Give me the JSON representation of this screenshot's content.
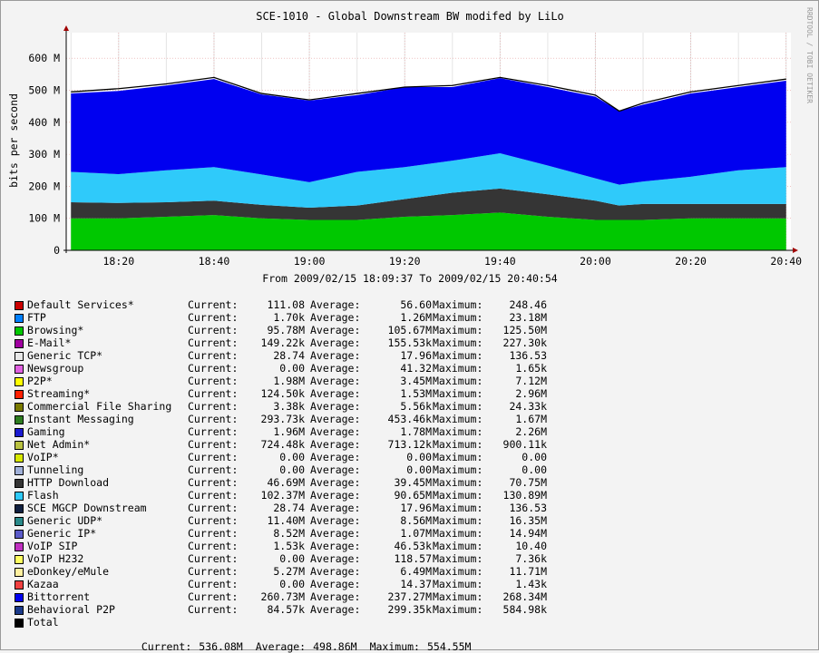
{
  "chart_data": {
    "type": "area",
    "title": "SCE-1010 - Global Downstream BW modifed by LiLo",
    "ylabel": "bits per second",
    "side_label": "RRDTOOL / TOBI OETIKER",
    "time_range_text": "From 2009/02/15 18:09:37 To 2009/02/15 20:40:54",
    "x_ticks": [
      "18:20",
      "18:40",
      "19:00",
      "19:20",
      "19:40",
      "20:00",
      "20:20",
      "20:40"
    ],
    "y_ticks": [
      "0",
      "100 M",
      "200 M",
      "300 M",
      "400 M",
      "500 M",
      "600 M"
    ],
    "ylim": [
      0,
      680
    ],
    "xlim": [
      "18:09",
      "20:41"
    ],
    "grid": true,
    "stack_x": [
      "18:10",
      "18:20",
      "18:30",
      "18:40",
      "18:50",
      "19:00",
      "19:10",
      "19:20",
      "19:30",
      "19:40",
      "19:50",
      "20:00",
      "20:05",
      "20:10",
      "20:20",
      "20:30",
      "20:40"
    ],
    "stack_series": [
      {
        "name": "Browsing*",
        "color": "#00c800",
        "values": [
          100,
          100,
          105,
          110,
          100,
          95,
          95,
          105,
          110,
          118,
          105,
          95,
          95,
          95,
          100,
          100,
          100
        ]
      },
      {
        "name": "HTTP Download",
        "color": "#353535",
        "values": [
          50,
          48,
          45,
          45,
          42,
          38,
          45,
          55,
          70,
          75,
          70,
          60,
          45,
          50,
          45,
          45,
          45
        ]
      },
      {
        "name": "Flash",
        "color": "#2fcafa",
        "values": [
          95,
          90,
          100,
          105,
          95,
          80,
          105,
          100,
          100,
          110,
          90,
          70,
          65,
          70,
          85,
          105,
          115
        ]
      },
      {
        "name": "Bittorrent",
        "color": "#0000f0",
        "values": [
          245,
          260,
          265,
          275,
          250,
          255,
          240,
          250,
          230,
          235,
          245,
          255,
          230,
          240,
          260,
          260,
          270
        ]
      }
    ],
    "total_series": {
      "name": "Total",
      "color": "#000000",
      "values": [
        495,
        505,
        520,
        540,
        490,
        470,
        490,
        510,
        515,
        540,
        515,
        485,
        435,
        460,
        495,
        515,
        535
      ]
    },
    "legend": [
      {
        "name": "Default Services*",
        "color": "#cc0000",
        "current": "111.08",
        "average": "56.60",
        "maximum": "248.46"
      },
      {
        "name": "FTP",
        "color": "#0080ff",
        "current": "1.70k",
        "average": "1.26M",
        "maximum": "23.18M"
      },
      {
        "name": "Browsing*",
        "color": "#00c800",
        "current": "95.78M",
        "average": "105.67M",
        "maximum": "125.50M"
      },
      {
        "name": "E-Mail*",
        "color": "#a000a0",
        "current": "149.22k",
        "average": "155.53k",
        "maximum": "227.30k"
      },
      {
        "name": "Generic TCP*",
        "color": "#e8e8e8",
        "current": "28.74",
        "average": "17.96",
        "maximum": "136.53"
      },
      {
        "name": "Newsgroup",
        "color": "#e060e0",
        "current": "0.00",
        "average": "41.32",
        "maximum": "1.65k"
      },
      {
        "name": "P2P*",
        "color": "#ffff00",
        "current": "1.98M",
        "average": "3.45M",
        "maximum": "7.12M"
      },
      {
        "name": "Streaming*",
        "color": "#ff2000",
        "current": "124.50k",
        "average": "1.53M",
        "maximum": "2.96M"
      },
      {
        "name": "Commercial File Sharing",
        "color": "#7a7a00",
        "current": "3.38k",
        "average": "5.56k",
        "maximum": "24.33k"
      },
      {
        "name": "Instant Messaging",
        "color": "#2e7d20",
        "current": "293.73k",
        "average": "453.46k",
        "maximum": "1.67M"
      },
      {
        "name": "Gaming",
        "color": "#1a1ad0",
        "current": "1.96M",
        "average": "1.78M",
        "maximum": "2.26M"
      },
      {
        "name": "Net Admin*",
        "color": "#b8c040",
        "current": "724.48k",
        "average": "713.12k",
        "maximum": "900.11k"
      },
      {
        "name": "VoIP*",
        "color": "#d8e800",
        "current": "0.00",
        "average": "0.00",
        "maximum": "0.00"
      },
      {
        "name": "Tunneling",
        "color": "#a0b0d8",
        "current": "0.00",
        "average": "0.00",
        "maximum": "0.00"
      },
      {
        "name": "HTTP Download",
        "color": "#353535",
        "current": "46.69M",
        "average": "39.45M",
        "maximum": "70.75M"
      },
      {
        "name": "Flash",
        "color": "#2fcafa",
        "current": "102.37M",
        "average": "90.65M",
        "maximum": "130.89M"
      },
      {
        "name": "SCE MGCP Downstream",
        "color": "#102040",
        "current": "28.74",
        "average": "17.96",
        "maximum": "136.53"
      },
      {
        "name": "Generic UDP*",
        "color": "#2a8a8a",
        "current": "11.40M",
        "average": "8.56M",
        "maximum": "16.35M"
      },
      {
        "name": "Generic IP*",
        "color": "#5a5ac8",
        "current": "8.52M",
        "average": "1.07M",
        "maximum": "14.94M"
      },
      {
        "name": "VoIP SIP",
        "color": "#c030c0",
        "current": "1.53k",
        "average": "46.53k",
        "maximum": "10.40"
      },
      {
        "name": "VoIP H232",
        "color": "#ffff60",
        "current": "0.00",
        "average": "118.57",
        "maximum": "7.36k"
      },
      {
        "name": "eDonkey/eMule",
        "color": "#fff0a0",
        "current": "5.27M",
        "average": "6.49M",
        "maximum": "11.71M"
      },
      {
        "name": "Kazaa",
        "color": "#f04040",
        "current": "0.00",
        "average": "14.37",
        "maximum": "1.43k"
      },
      {
        "name": "Bittorrent",
        "color": "#0000f0",
        "current": "260.73M",
        "average": "237.27M",
        "maximum": "268.34M"
      },
      {
        "name": "Behavioral P2P",
        "color": "#1a3a8a",
        "current": "84.57k",
        "average": "299.35k",
        "maximum": "584.98k"
      },
      {
        "name": "Total",
        "color": "#000000",
        "current": "",
        "average": "",
        "maximum": ""
      }
    ],
    "labels": {
      "current": "Current:",
      "average": "Average:",
      "maximum": "Maximum:"
    },
    "totals": {
      "current": "536.08M",
      "average": "498.86M",
      "maximum": "554.55M"
    }
  }
}
